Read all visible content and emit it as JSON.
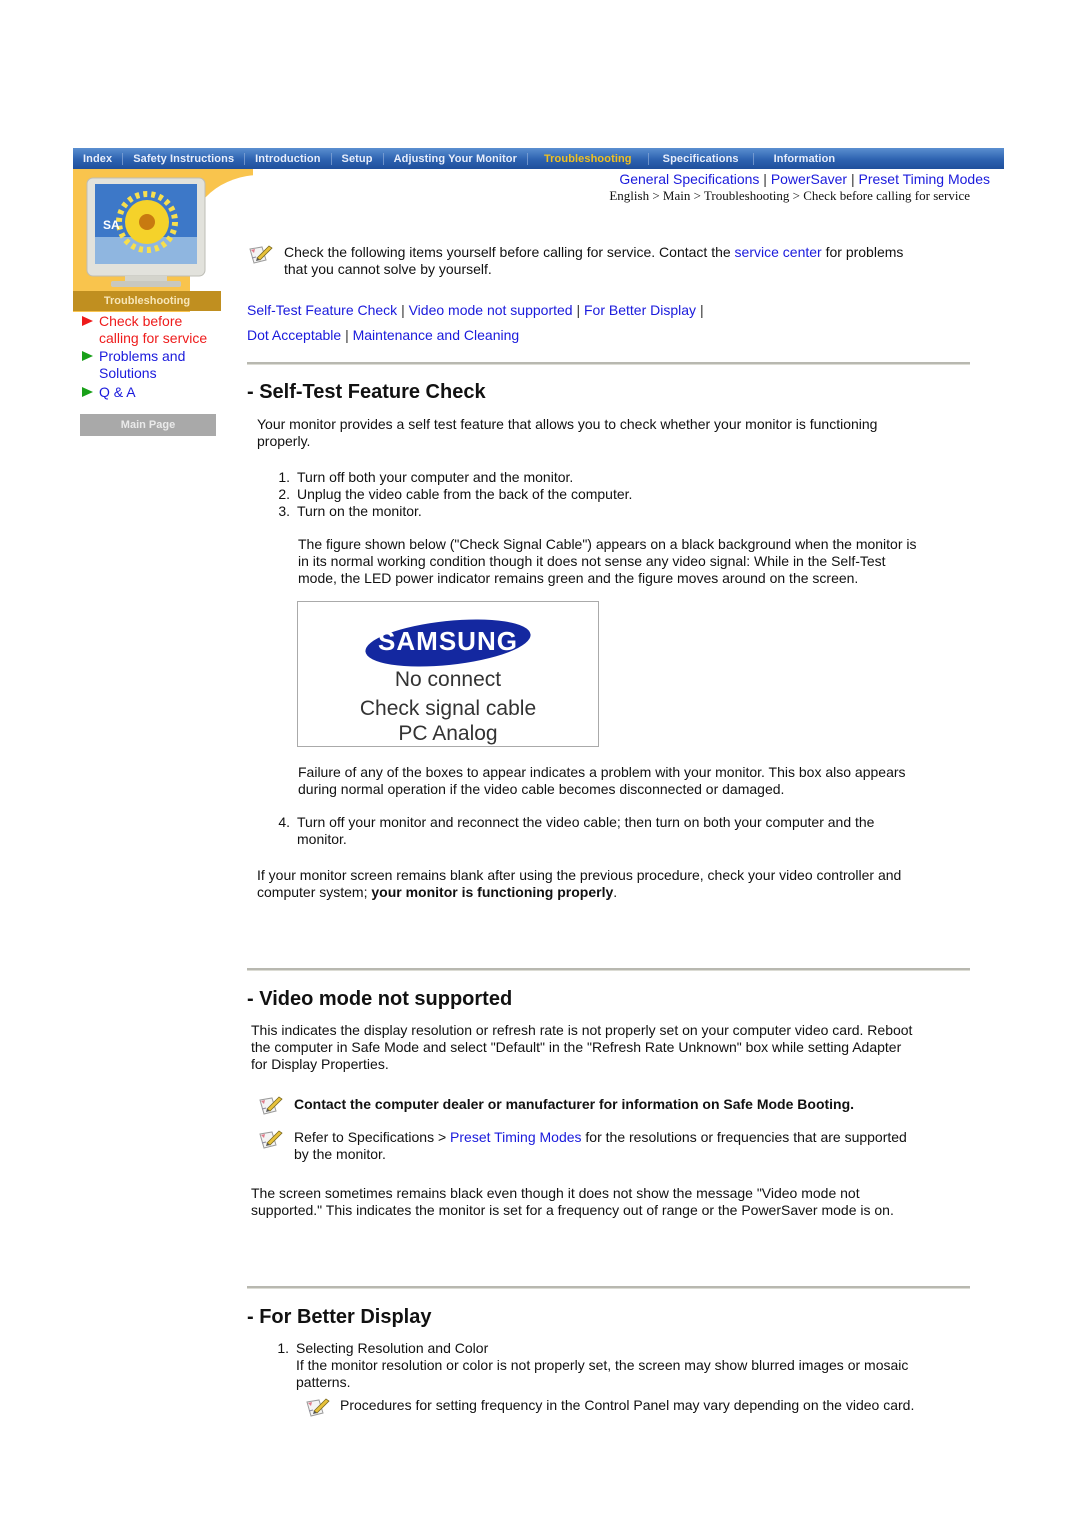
{
  "nav": {
    "items": [
      {
        "label": "Index",
        "active": false
      },
      {
        "label": "Safety Instructions",
        "active": false
      },
      {
        "label": "Introduction",
        "active": false
      },
      {
        "label": "Setup",
        "active": false
      },
      {
        "label": "Adjusting Your Monitor",
        "active": false
      },
      {
        "label": "Troubleshooting",
        "active": true
      },
      {
        "label": "Specifications",
        "active": false
      },
      {
        "label": "Information",
        "active": false
      }
    ]
  },
  "sidebar": {
    "banner_label": "Troubleshooting",
    "monitor_screen_text": "SA",
    "items": [
      {
        "label_line1": "Check before",
        "label_line2": "calling for service",
        "active": true
      },
      {
        "label_line1": "Problems and",
        "label_line2": "Solutions",
        "active": false
      },
      {
        "label_line1": "Q & A",
        "label_line2": "",
        "active": false
      }
    ],
    "main_page_button": "Main Page"
  },
  "top_links": {
    "items": [
      "General Specifications",
      "PowerSaver",
      "Preset Timing Modes"
    ],
    "separator": "|"
  },
  "breadcrumb": "English > Main > Troubleshooting > Check before calling for service",
  "intro": {
    "text_before": "Check the following items yourself before calling for service. Contact the ",
    "link": "service center",
    "text_after": " for problems",
    "line2": "that you cannot solve by yourself."
  },
  "section_links": {
    "row1": [
      "Self-Test Feature Check",
      "Video mode not supported",
      "For Better Display"
    ],
    "row2": [
      "Dot Acceptable",
      "Maintenance and Cleaning"
    ],
    "separator": "|"
  },
  "self_test": {
    "title": "- Self-Test Feature Check",
    "intro_l1": "Your monitor provides a self test feature that allows you to check whether your monitor is functioning",
    "intro_l2": "properly.",
    "steps": [
      "Turn off both your computer and the monitor.",
      "Unplug the video cable from the back of the computer.",
      "Turn on the monitor."
    ],
    "figure_desc_l1": "The figure shown below (\"Check Signal Cable\") appears on a black background when the monitor is",
    "figure_desc_l2": "in its normal working condition though it does not sense any video signal: While in the Self-Test",
    "figure_desc_l3": "mode, the LED power indicator remains green and the figure moves around on the screen.",
    "figure": {
      "logo": "SAMSUNG",
      "line1": "No connect",
      "line2": "Check signal cable",
      "line3": "PC Analog"
    },
    "failure_l1": "Failure of any of the boxes to appear indicates a problem with your monitor. This box also appears",
    "failure_l2": "during normal operation if the video cable becomes disconnected or damaged.",
    "step4_l1": "Turn off your monitor and reconnect the video cable; then turn on both your computer and the",
    "step4_l2": "monitor.",
    "step4_num": "4.",
    "closing_l1": "If your monitor screen remains blank after using the previous procedure, check your video controller and",
    "closing_l2_plain": "computer system; ",
    "closing_l2_bold": "your monitor is functioning properly",
    "closing_l2_end": "."
  },
  "video_mode": {
    "title": "- Video mode not supported",
    "p1_l1": "This indicates the display resolution or refresh rate is not properly set on your computer video card. Reboot",
    "p1_l2": "the computer in Safe Mode and select \"Default\" in the \"Refresh Rate Unknown\" box while setting Adapter",
    "p1_l3": "for Display Properties.",
    "note1": "Contact the computer dealer or manufacturer for information on Safe Mode Booting.",
    "note2_before": "Refer to Specifications > ",
    "note2_link": "Preset Timing Modes",
    "note2_after": " for the resolutions or frequencies that are supported",
    "note2_l2": "by the monitor.",
    "p2_l1": "The screen sometimes remains black even though it does not show the message \"Video mode not",
    "p2_l2": "supported.\" This indicates the monitor is set for a frequency out of range or the PowerSaver mode is on."
  },
  "better_display": {
    "title": "- For Better Display",
    "step1_num": "1.",
    "step1_title": "Selecting Resolution and Color",
    "step1_l1": "If the monitor resolution or color is not properly set, the screen may show blurred images or mosaic",
    "step1_l2": "patterns.",
    "note": "Procedures for setting frequency in the Control Panel may vary depending on the video card."
  }
}
